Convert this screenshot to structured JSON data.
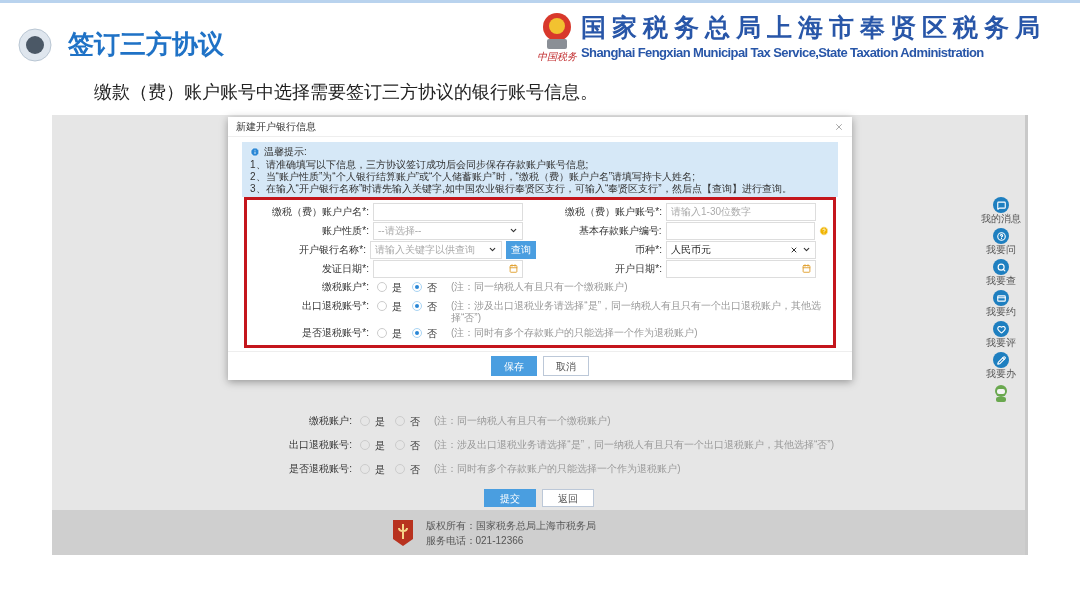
{
  "slide": {
    "title": "签订三方协议",
    "org_name_cn": "国家税务总局上海市奉贤区税务局",
    "org_name_en": "Shanghai Fengxian Municipal Tax Service,State Taxation Administration",
    "logo_caption": "中国税务",
    "subtitle": "缴款（费）账户账号中选择需要签订三方协议的银行账号信息。"
  },
  "page": {
    "background_rows": [
      {
        "label": "缴税账户:",
        "options": [
          {
            "label": "是",
            "selected": false
          },
          {
            "label": "否",
            "selected": false
          }
        ],
        "note": "(注：同一纳税人有且只有一个缴税账户)"
      },
      {
        "label": "出口退税账号:",
        "options": [
          {
            "label": "是",
            "selected": false
          },
          {
            "label": "否",
            "selected": false
          }
        ],
        "note": "(注：涉及出口退税业务请选择“是”，同一纳税人有且只有一个出口退税账户，其他选择“否”)"
      },
      {
        "label": "是否退税账号:",
        "options": [
          {
            "label": "是",
            "selected": false
          },
          {
            "label": "否",
            "selected": false
          }
        ],
        "note": "(注：同时有多个存款账户的只能选择一个作为退税账户)"
      }
    ],
    "buttons": [
      {
        "label": "提交",
        "kind": "primary"
      },
      {
        "label": "返回",
        "kind": "secondary"
      }
    ],
    "sidebar": [
      {
        "label": "我的消息"
      },
      {
        "label": "我要问"
      },
      {
        "label": "我要查"
      },
      {
        "label": "我要约"
      },
      {
        "label": "我要评"
      },
      {
        "label": "我要办"
      }
    ],
    "footer": {
      "copyright": "版权所有：国家税务总局上海市税务局",
      "phone": "服务电话：021-12366"
    }
  },
  "dialog": {
    "title": "新建开户银行信息",
    "notice": {
      "heading": "温馨提示:",
      "lines": [
        "1、请准确填写以下信息，三方协议签订成功后会同步保存存款账户账号信息;",
        "2、当“账户性质”为“个人银行结算账户”或“个人储蓄账户”时，“缴税（费）账户户名”请填写持卡人姓名;",
        "3、在输入“开户银行名称”时请先输入关键字,如中国农业银行奉贤区支行，可输入“奉贤区支行”，然后点【查询】进行查询。"
      ]
    },
    "fields": [
      {
        "label": "缴税（费）账户户名*:",
        "kind": "text"
      },
      {
        "label": "缴税（费）账户账号*:",
        "kind": "text",
        "placeholder": "请输入1-30位数字"
      },
      {
        "label": "账户性质*:",
        "kind": "select",
        "placeholder": "--请选择--"
      },
      {
        "label": "基本存款账户编号:",
        "kind": "text",
        "help": true
      },
      {
        "label": "开户银行名称*:",
        "kind": "select",
        "placeholder": "请输入关键字以供查询",
        "action": "查询"
      },
      {
        "label": "币种*:",
        "kind": "combo",
        "value": "人民币元"
      },
      {
        "label": "发证日期*:",
        "kind": "date"
      },
      {
        "label": "开户日期*:",
        "kind": "date"
      }
    ],
    "radio_rows": [
      {
        "label": "缴税账户*:",
        "options": [
          {
            "label": "是",
            "selected": false
          },
          {
            "label": "否",
            "selected": true
          }
        ],
        "note": "(注：同一纳税人有且只有一个缴税账户)"
      },
      {
        "label": "出口退税账号*:",
        "options": [
          {
            "label": "是",
            "selected": false
          },
          {
            "label": "否",
            "selected": true
          }
        ],
        "note": "(注：涉及出口退税业务请选择“是”，同一纳税人有且只有一个出口退税账户，其他选择“否”)"
      },
      {
        "label": "是否退税账号*:",
        "options": [
          {
            "label": "是",
            "selected": false
          },
          {
            "label": "否",
            "selected": true
          }
        ],
        "note": "(注：同时有多个存款账户的只能选择一个作为退税账户)"
      }
    ],
    "buttons": [
      {
        "label": "保存",
        "kind": "primary"
      },
      {
        "label": "取消",
        "kind": "secondary"
      }
    ]
  }
}
